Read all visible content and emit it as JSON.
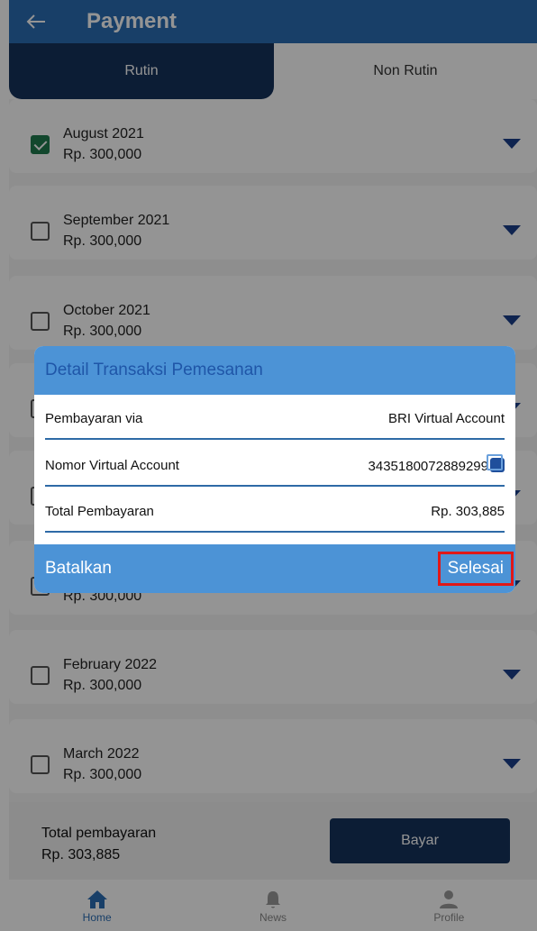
{
  "header": {
    "title": "Payment",
    "back_icon": "arrow-left-icon"
  },
  "tabs": [
    {
      "label": "Rutin",
      "active": true
    },
    {
      "label": "Non Rutin",
      "active": false
    }
  ],
  "months": [
    {
      "label": "August 2021",
      "amount": "Rp. 300,000",
      "checked": true
    },
    {
      "label": "September 2021",
      "amount": "Rp. 300,000",
      "checked": false
    },
    {
      "label": "October 2021",
      "amount": "Rp. 300,000",
      "checked": false
    },
    {
      "label": "",
      "amount": "",
      "checked": false
    },
    {
      "label": "",
      "amount": "",
      "checked": false
    },
    {
      "label": "",
      "amount": "Rp. 300,000",
      "checked": false
    },
    {
      "label": "February 2022",
      "amount": "Rp. 300,000",
      "checked": false
    },
    {
      "label": "March 2022",
      "amount": "Rp. 300,000",
      "checked": false
    }
  ],
  "footer": {
    "total_label": "Total pembayaran",
    "total_value": "Rp. 303,885",
    "pay_label": "Bayar"
  },
  "nav": [
    {
      "label": "Home",
      "icon": "home-icon",
      "active": true
    },
    {
      "label": "News",
      "icon": "bell-icon",
      "active": false
    },
    {
      "label": "Profile",
      "icon": "user-icon",
      "active": false
    }
  ],
  "dialog": {
    "title": "Detail Transaksi Pemesanan",
    "rows": [
      {
        "label": "Pembayaran via",
        "value": "BRI Virtual Account"
      },
      {
        "label": "Nomor Virtual Account",
        "value": "3435180072889299"
      },
      {
        "label": "Total Pembayaran",
        "value": "Rp. 303,885"
      }
    ],
    "cancel_label": "Batalkan",
    "finish_label": "Selesai",
    "highlight_color": "#e01818"
  },
  "colors": {
    "primary": "#16325c",
    "header": "#2a6db4",
    "dialog_accent": "#4c93d6",
    "check": "#1f7a4f"
  }
}
